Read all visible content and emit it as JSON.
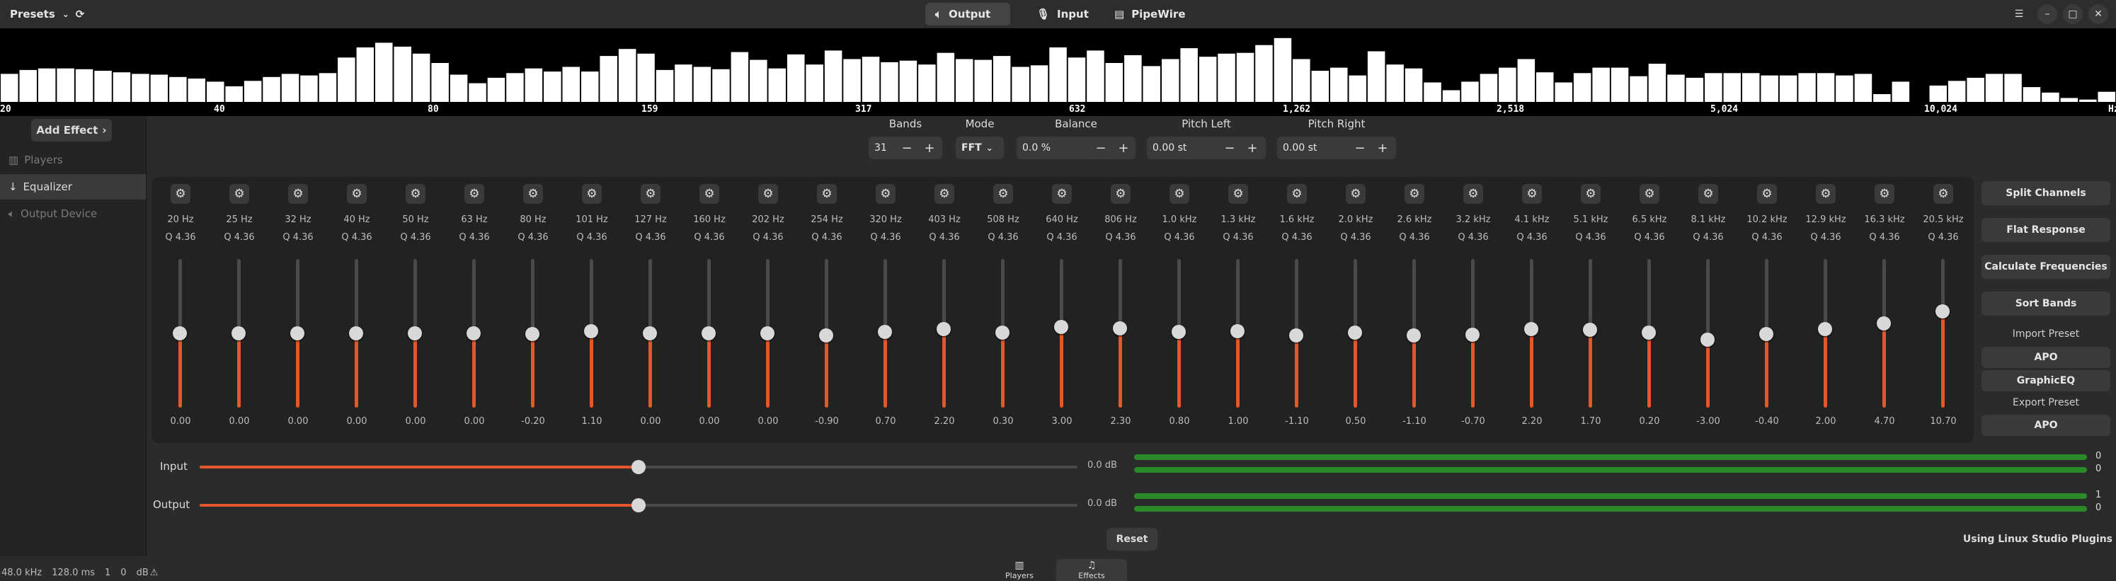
{
  "header": {
    "presets_label": "Presets",
    "tabs": [
      {
        "label": "Output",
        "icon": "speaker-icon",
        "active": true
      },
      {
        "label": "Input",
        "icon": "microphone-icon",
        "active": false
      },
      {
        "label": "PipeWire",
        "icon": "document-icon",
        "active": false
      }
    ]
  },
  "spectrum": {
    "bars": [
      36,
      41,
      43,
      43,
      42,
      40,
      38,
      36,
      35,
      32,
      30,
      26,
      20,
      27,
      32,
      36,
      34,
      37,
      57,
      70,
      76,
      71,
      62,
      50,
      35,
      24,
      31,
      37,
      43,
      39,
      45,
      39,
      59,
      68,
      62,
      41,
      48,
      45,
      42,
      64,
      54,
      43,
      61,
      48,
      66,
      55,
      58,
      51,
      53,
      48,
      63,
      55,
      54,
      59,
      45,
      47,
      70,
      57,
      66,
      50,
      60,
      46,
      55,
      69,
      58,
      62,
      63,
      73,
      82,
      55,
      40,
      44,
      34,
      65,
      48,
      43,
      25,
      15,
      26,
      36,
      44,
      55,
      38,
      25,
      37,
      44,
      44,
      33,
      49,
      35,
      31,
      37,
      37,
      37,
      34,
      34,
      37,
      37,
      34,
      36,
      10,
      26,
      0,
      21,
      27,
      31,
      36,
      36,
      19,
      12,
      5,
      3,
      13
    ],
    "labels": [
      "20",
      "40",
      "80",
      "159",
      "317",
      "632",
      "1,262",
      "2,518",
      "5,024",
      "10,024",
      "Hz"
    ]
  },
  "sidebar": {
    "add_effect_label": "Add Effect",
    "items": [
      {
        "label": "Players",
        "icon": "players-icon",
        "selected": false,
        "dim": true
      },
      {
        "label": "Equalizer",
        "icon": "arrow-down-icon",
        "selected": true,
        "dim": false
      },
      {
        "label": "Output Device",
        "icon": "speaker-icon",
        "selected": false,
        "dim": true
      }
    ]
  },
  "controls": {
    "bands_label": "Bands",
    "bands_value": "31",
    "mode_label": "Mode",
    "mode_value": "FFT",
    "balance_label": "Balance",
    "balance_value": "0.0 %",
    "pitch_left_label": "Pitch Left",
    "pitch_left_value": "0.00 st",
    "pitch_right_label": "Pitch Right",
    "pitch_right_value": "0.00 st"
  },
  "bands": [
    {
      "freq": "20 Hz",
      "q": "Q 4.36",
      "gain": "0.00"
    },
    {
      "freq": "25 Hz",
      "q": "Q 4.36",
      "gain": "0.00"
    },
    {
      "freq": "32 Hz",
      "q": "Q 4.36",
      "gain": "0.00"
    },
    {
      "freq": "40 Hz",
      "q": "Q 4.36",
      "gain": "0.00"
    },
    {
      "freq": "50 Hz",
      "q": "Q 4.36",
      "gain": "0.00"
    },
    {
      "freq": "63 Hz",
      "q": "Q 4.36",
      "gain": "0.00"
    },
    {
      "freq": "80 Hz",
      "q": "Q 4.36",
      "gain": "-0.20"
    },
    {
      "freq": "101 Hz",
      "q": "Q 4.36",
      "gain": "1.10"
    },
    {
      "freq": "127 Hz",
      "q": "Q 4.36",
      "gain": "0.00"
    },
    {
      "freq": "160 Hz",
      "q": "Q 4.36",
      "gain": "0.00"
    },
    {
      "freq": "202 Hz",
      "q": "Q 4.36",
      "gain": "0.00"
    },
    {
      "freq": "254 Hz",
      "q": "Q 4.36",
      "gain": "-0.90"
    },
    {
      "freq": "320 Hz",
      "q": "Q 4.36",
      "gain": "0.70"
    },
    {
      "freq": "403 Hz",
      "q": "Q 4.36",
      "gain": "2.20"
    },
    {
      "freq": "508 Hz",
      "q": "Q 4.36",
      "gain": "0.30"
    },
    {
      "freq": "640 Hz",
      "q": "Q 4.36",
      "gain": "3.00"
    },
    {
      "freq": "806 Hz",
      "q": "Q 4.36",
      "gain": "2.30"
    },
    {
      "freq": "1.0 kHz",
      "q": "Q 4.36",
      "gain": "0.80"
    },
    {
      "freq": "1.3 kHz",
      "q": "Q 4.36",
      "gain": "1.00"
    },
    {
      "freq": "1.6 kHz",
      "q": "Q 4.36",
      "gain": "-1.10"
    },
    {
      "freq": "2.0 kHz",
      "q": "Q 4.36",
      "gain": "0.50"
    },
    {
      "freq": "2.6 kHz",
      "q": "Q 4.36",
      "gain": "-1.10"
    },
    {
      "freq": "3.2 kHz",
      "q": "Q 4.36",
      "gain": "-0.70"
    },
    {
      "freq": "4.1 kHz",
      "q": "Q 4.36",
      "gain": "2.20"
    },
    {
      "freq": "5.1 kHz",
      "q": "Q 4.36",
      "gain": "1.70"
    },
    {
      "freq": "6.5 kHz",
      "q": "Q 4.36",
      "gain": "0.20"
    },
    {
      "freq": "8.1 kHz",
      "q": "Q 4.36",
      "gain": "-3.00"
    },
    {
      "freq": "10.2 kHz",
      "q": "Q 4.36",
      "gain": "-0.40"
    },
    {
      "freq": "12.9 kHz",
      "q": "Q 4.36",
      "gain": "2.00"
    },
    {
      "freq": "16.3 kHz",
      "q": "Q 4.36",
      "gain": "4.70"
    },
    {
      "freq": "20.5 kHz",
      "q": "Q 4.36",
      "gain": "10.70"
    }
  ],
  "gain_range": [
    -36,
    36
  ],
  "right_panel": {
    "split_channels": "Split Channels",
    "flat_response": "Flat Response",
    "calculate_frequencies": "Calculate Frequencies",
    "sort_bands": "Sort Bands",
    "import_preset_label": "Import Preset",
    "import_apo": "APO",
    "import_graphiceq": "GraphicEQ",
    "export_preset_label": "Export Preset",
    "export_apo": "APO"
  },
  "levels": {
    "input_label": "Input",
    "input_value": "0.0 dB",
    "input_level": 0.5,
    "output_label": "Output",
    "output_value": "0.0 dB",
    "output_level": 0.5,
    "input_meter_vals": [
      "0",
      "0"
    ],
    "output_meter_vals": [
      "1",
      "0"
    ]
  },
  "reset_label": "Reset",
  "plugins_credit": "Using Linux Studio Plugins",
  "status": {
    "rate": "48.0 kHz",
    "latency": "128.0 ms",
    "v1": "1",
    "v2": "0",
    "unit": "dB"
  },
  "bottom_tabs": [
    {
      "label": "Players",
      "icon": "players-icon",
      "active": false
    },
    {
      "label": "Effects",
      "icon": "music-note-icon",
      "active": true
    }
  ]
}
